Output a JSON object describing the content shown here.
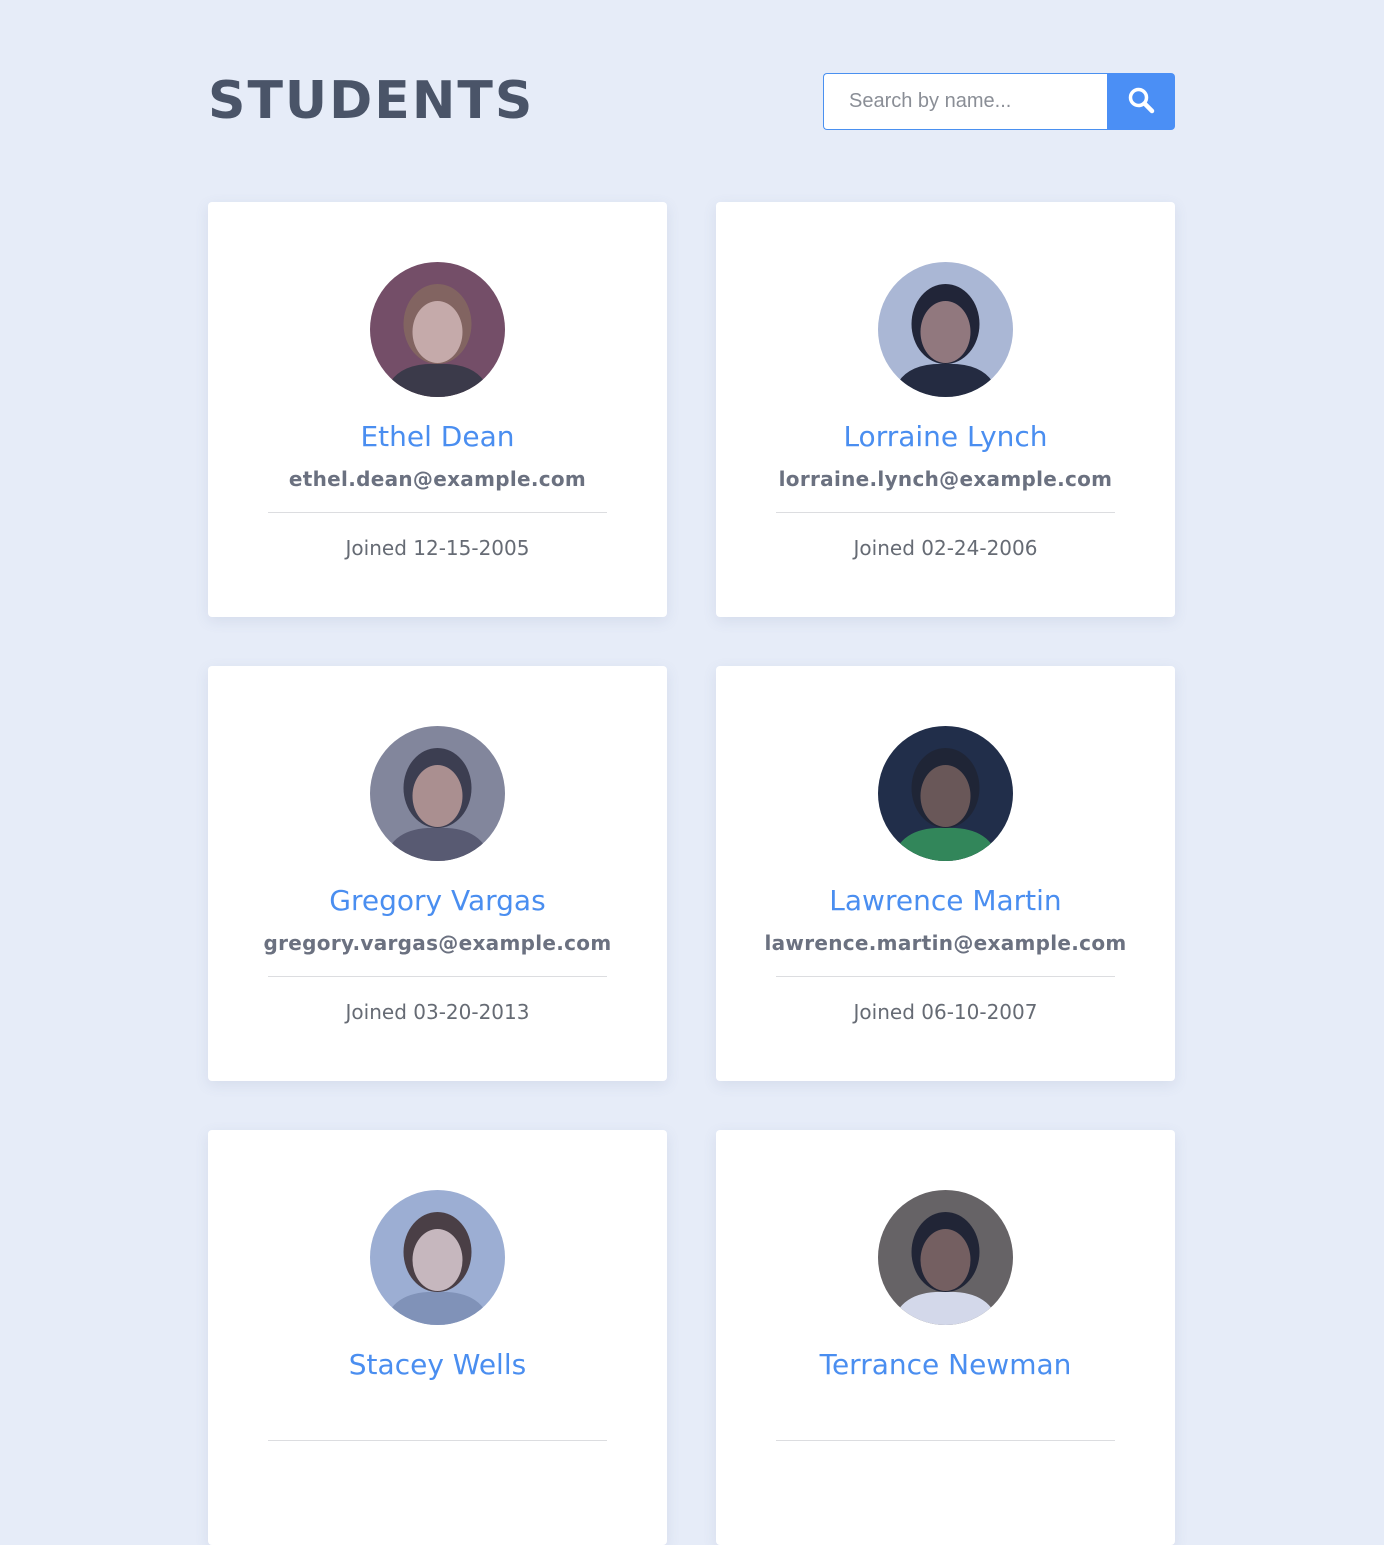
{
  "page": {
    "title": "STUDENTS",
    "background_color": "#e6ecf8",
    "accent_color": "#4b8ff5"
  },
  "search": {
    "placeholder": "Search by name...",
    "value": "",
    "button_icon": "search-icon"
  },
  "students": [
    {
      "name": "Ethel Dean",
      "email": "ethel.dean@example.com",
      "joined": "Joined 12-15-2005",
      "avatar": {
        "skin": "#d6b3a6",
        "hair": "#8a6452",
        "bg": "#7a4a5a",
        "top": "#3a3438"
      }
    },
    {
      "name": "Lorraine Lynch",
      "email": "lorraine.lynch@example.com",
      "joined": "Joined 02-24-2006",
      "avatar": {
        "skin": "#9b7a73",
        "hair": "#1c1c24",
        "bg": "#b8c2d6",
        "top": "#1f232e"
      }
    },
    {
      "name": "Gregory Vargas",
      "email": "gregory.vargas@example.com",
      "joined": "Joined 03-20-2013",
      "avatar": {
        "skin": "#b89488",
        "hair": "#3b3840",
        "bg": "#8a8a96",
        "top": "#5a5866"
      }
    },
    {
      "name": "Lawrence Martin",
      "email": "lawrence.martin@example.com",
      "joined": "Joined 06-10-2007",
      "avatar": {
        "skin": "#6e5548",
        "hair": "#1a1c22",
        "bg": "#1c2638",
        "top": "#2f8a4a"
      }
    },
    {
      "name": "Stacey Wells",
      "email": "",
      "joined": "",
      "avatar": {
        "skin": "#d8c2bc",
        "hair": "#4a3a34",
        "bg": "#a8b8d4",
        "top": "#8898b6"
      }
    },
    {
      "name": "Terrance Newman",
      "email": "",
      "joined": "",
      "avatar": {
        "skin": "#7a5e52",
        "hair": "#1c1c22",
        "bg": "#6a6258",
        "top": "#e6e8ee"
      }
    }
  ]
}
